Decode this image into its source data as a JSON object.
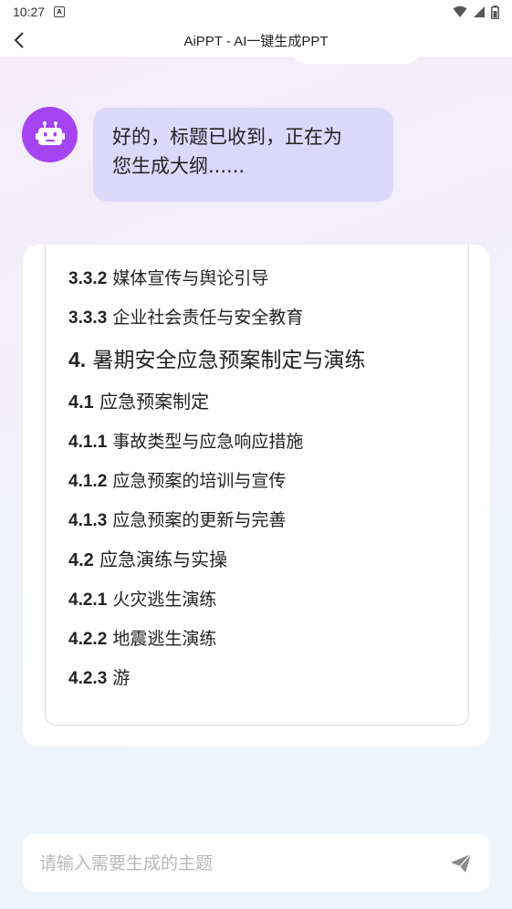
{
  "status_bar": {
    "time": "10:27",
    "notification_icon": "A",
    "icons": [
      "wifi-icon",
      "signal-icon",
      "battery-icon"
    ]
  },
  "app_bar": {
    "title": "AiPPT - AI一键生成PPT"
  },
  "chat": {
    "ai_message_line1": "好的，标题已收到，正在为",
    "ai_message_line2": "您生成大纲......"
  },
  "outline": {
    "items": [
      {
        "num": "3.3.2",
        "text": "媒体宣传与舆论引导",
        "level": 3
      },
      {
        "num": "3.3.3",
        "text": "企业社会责任与安全教育",
        "level": 3
      },
      {
        "num": "4.",
        "text": "暑期安全应急预案制定与演练",
        "level": 1
      },
      {
        "num": "4.1",
        "text": "应急预案制定",
        "level": 2
      },
      {
        "num": "4.1.1",
        "text": "事故类型与应急响应措施",
        "level": 3
      },
      {
        "num": "4.1.2",
        "text": "应急预案的培训与宣传",
        "level": 3
      },
      {
        "num": "4.1.3",
        "text": "应急预案的更新与完善",
        "level": 3
      },
      {
        "num": "4.2",
        "text": "应急演练与实操",
        "level": 2
      },
      {
        "num": "4.2.1",
        "text": "火灾逃生演练",
        "level": 3
      },
      {
        "num": "4.2.2",
        "text": "地震逃生演练",
        "level": 3
      },
      {
        "num": "4.2.3",
        "text": "游",
        "level": 3
      }
    ]
  },
  "input": {
    "placeholder": "请输入需要生成的主题"
  },
  "colors": {
    "avatar_bg": "#a544f2",
    "ai_bubble_bg": "#dcd8fa",
    "send_icon": "#8a8a8a"
  }
}
